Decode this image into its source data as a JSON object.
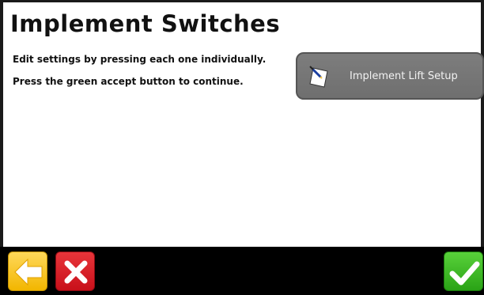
{
  "header": {
    "title": "Implement Switches"
  },
  "instructions": {
    "line1": "Edit settings by pressing each one individually.",
    "line2": "Press the green accept button to continue."
  },
  "settings": {
    "implement_lift_setup": {
      "label": "Implement Lift Setup",
      "icon": "notepad-pencil-icon"
    }
  },
  "footer": {
    "back_icon": "left-arrow-icon",
    "cancel_icon": "close-x-icon",
    "accept_icon": "checkmark-icon"
  },
  "colors": {
    "back": "#f2b600",
    "cancel": "#c8101a",
    "accept": "#2aa316",
    "setup_button": "#777777"
  }
}
